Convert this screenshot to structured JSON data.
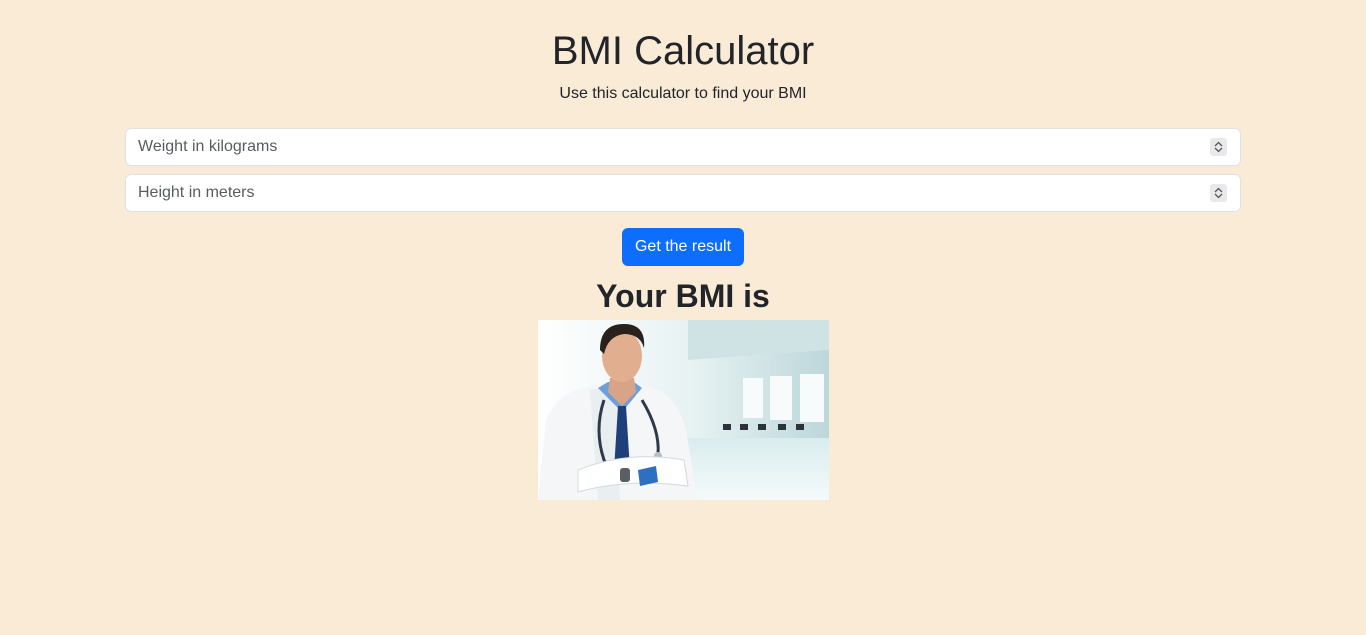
{
  "header": {
    "title": "BMI Calculator",
    "subtitle": "Use this calculator to find your BMI"
  },
  "form": {
    "weight": {
      "placeholder": "Weight in kilograms",
      "value": ""
    },
    "height": {
      "placeholder": "Height in meters",
      "value": ""
    },
    "submit_label": "Get the result"
  },
  "result": {
    "label": "Your BMI is"
  },
  "image": {
    "subject": "doctor-with-stethoscope-photo"
  },
  "colors": {
    "background": "#faebd7",
    "button": "#0d6efd",
    "text": "#212529"
  }
}
